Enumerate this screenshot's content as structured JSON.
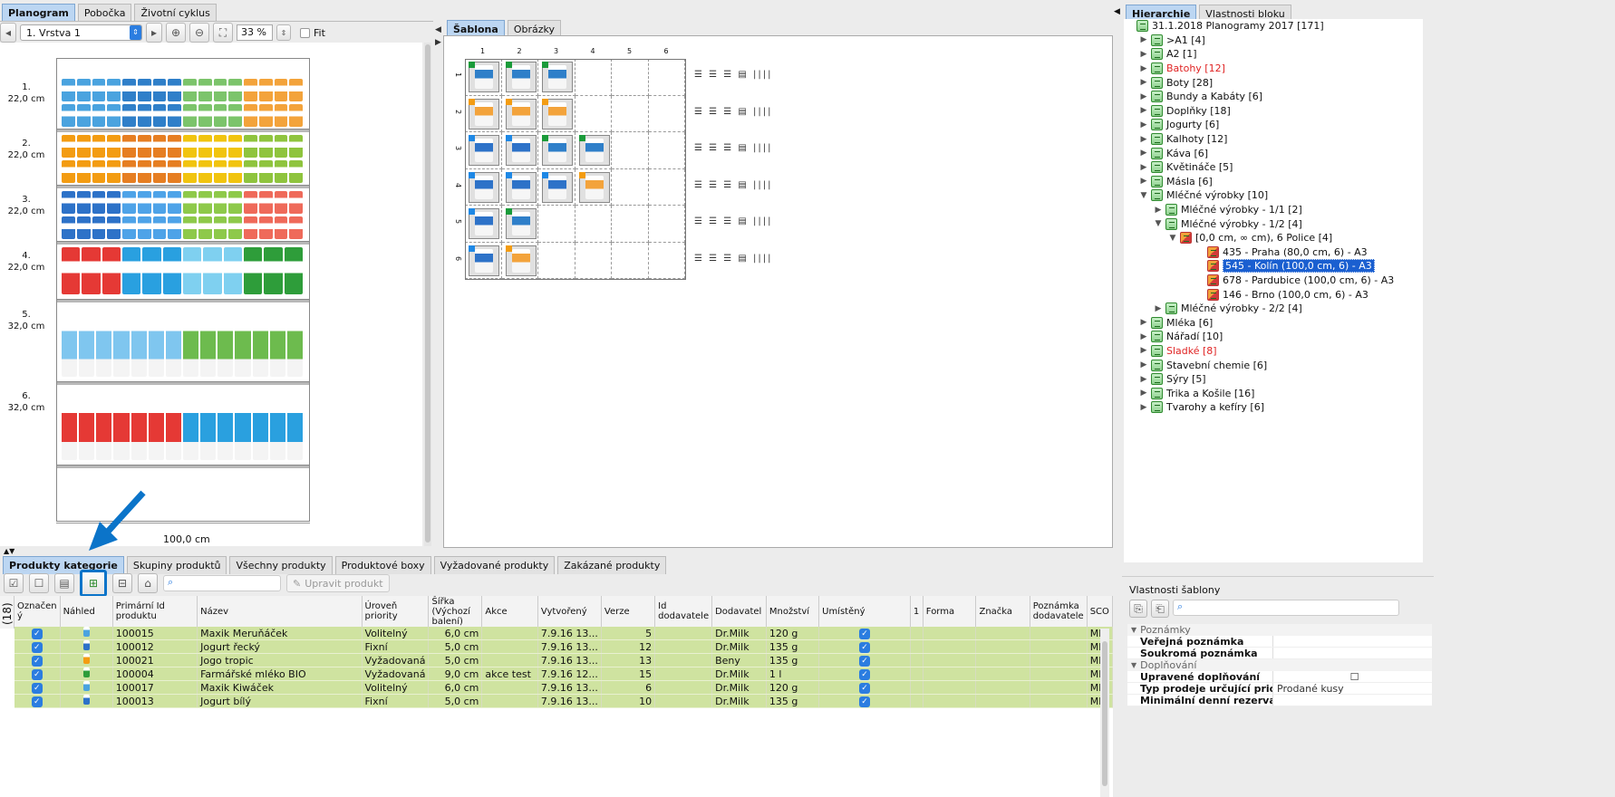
{
  "left_tabs": [
    {
      "label": "Planogram",
      "active": true
    },
    {
      "label": "Pobočka",
      "active": false
    },
    {
      "label": "Životní cyklus",
      "active": false
    }
  ],
  "toolbar": {
    "layer": "1. Vrstva 1",
    "zoom": "33 %",
    "fit": "Fit"
  },
  "shelves": [
    {
      "num": "1.",
      "h": "22,0 cm"
    },
    {
      "num": "2.",
      "h": "22,0 cm"
    },
    {
      "num": "3.",
      "h": "22,0 cm"
    },
    {
      "num": "4.",
      "h": "22,0 cm"
    },
    {
      "num": "5.",
      "h": "32,0 cm"
    },
    {
      "num": "6.",
      "h": "32,0 cm"
    }
  ],
  "width_label": "100,0 cm",
  "center_tabs": [
    {
      "label": "Šablona",
      "active": true
    },
    {
      "label": "Obrázky",
      "active": false
    }
  ],
  "template": {
    "cols": [
      "1",
      "2",
      "3",
      "4",
      "5",
      "6"
    ],
    "rows": [
      "1",
      "2",
      "3",
      "4",
      "5",
      "6"
    ],
    "cells": [
      [
        "g",
        "g",
        "g"
      ],
      [
        "o",
        "o",
        "o"
      ],
      [
        "b",
        "b",
        "g",
        "g"
      ],
      [
        "b",
        "b",
        "b",
        "o"
      ],
      [
        "b",
        "g"
      ],
      [
        "b",
        "o"
      ]
    ]
  },
  "right_tabs": [
    {
      "label": "Hierarchie",
      "active": true
    },
    {
      "label": "Vlastnosti bloku",
      "active": false
    }
  ],
  "tree": [
    {
      "t": "31.1.2018 Planogramy 2017 [171]",
      "lvl": 0,
      "tw": "",
      "icon": "doc",
      "red": false
    },
    {
      "t": ">A1 [4]",
      "lvl": 1,
      "tw": "▶",
      "icon": "list",
      "red": false
    },
    {
      "t": "A2 [1]",
      "lvl": 1,
      "tw": "▶",
      "icon": "list",
      "red": false
    },
    {
      "t": "Batohy [12]",
      "lvl": 1,
      "tw": "▶",
      "icon": "list",
      "red": true
    },
    {
      "t": "Boty [28]",
      "lvl": 1,
      "tw": "▶",
      "icon": "list",
      "red": false
    },
    {
      "t": "Bundy a Kabáty [6]",
      "lvl": 1,
      "tw": "▶",
      "icon": "list",
      "red": false
    },
    {
      "t": "Doplňky [18]",
      "lvl": 1,
      "tw": "▶",
      "icon": "list",
      "red": false
    },
    {
      "t": "Jogurty [6]",
      "lvl": 1,
      "tw": "▶",
      "icon": "list",
      "red": false
    },
    {
      "t": "Kalhoty [12]",
      "lvl": 1,
      "tw": "▶",
      "icon": "list",
      "red": false
    },
    {
      "t": "Káva [6]",
      "lvl": 1,
      "tw": "▶",
      "icon": "list",
      "red": false
    },
    {
      "t": "Květináče [5]",
      "lvl": 1,
      "tw": "▶",
      "icon": "list",
      "red": false
    },
    {
      "t": "Másla [6]",
      "lvl": 1,
      "tw": "▶",
      "icon": "list",
      "red": false
    },
    {
      "t": "Mléčné výrobky [10]",
      "lvl": 1,
      "tw": "▼",
      "icon": "list",
      "red": false
    },
    {
      "t": "Mléčné výrobky - 1/1 [2]",
      "lvl": 2,
      "tw": "▶",
      "icon": "list",
      "red": false
    },
    {
      "t": "Mléčné výrobky - 1/2 [4]",
      "lvl": 2,
      "tw": "▼",
      "icon": "list",
      "red": false
    },
    {
      "t": "[0,0 cm, ∞ cm), 6 Police [4]",
      "lvl": 3,
      "tw": "▼",
      "icon": "store",
      "red": false
    },
    {
      "t": "435 - Praha  (80,0 cm, 6) - A3",
      "lvl": 4,
      "tw": "",
      "icon": "store",
      "red": false
    },
    {
      "t": "545 - Kolín (100,0 cm, 6) - A3",
      "lvl": 4,
      "tw": "",
      "icon": "store",
      "red": false,
      "sel": true
    },
    {
      "t": "678 - Pardubice  (100,0 cm, 6) - A3",
      "lvl": 4,
      "tw": "",
      "icon": "store",
      "red": false
    },
    {
      "t": "146 - Brno (100,0 cm, 6) - A3",
      "lvl": 4,
      "tw": "",
      "icon": "store",
      "red": false
    },
    {
      "t": "Mléčné výrobky - 2/2 [4]",
      "lvl": 2,
      "tw": "▶",
      "icon": "list",
      "red": false
    },
    {
      "t": "Mléka [6]",
      "lvl": 1,
      "tw": "▶",
      "icon": "list",
      "red": false
    },
    {
      "t": "Nářadí [10]",
      "lvl": 1,
      "tw": "▶",
      "icon": "list",
      "red": false
    },
    {
      "t": "Sladké [8]",
      "lvl": 1,
      "tw": "▶",
      "icon": "list",
      "red": true
    },
    {
      "t": "Stavební chemie [6]",
      "lvl": 1,
      "tw": "▶",
      "icon": "list",
      "red": false
    },
    {
      "t": "Sýry [5]",
      "lvl": 1,
      "tw": "▶",
      "icon": "list",
      "red": false
    },
    {
      "t": "Trika a Košile [16]",
      "lvl": 1,
      "tw": "▶",
      "icon": "list",
      "red": false
    },
    {
      "t": "Tvarohy a kefíry [6]",
      "lvl": 1,
      "tw": "▶",
      "icon": "list",
      "red": false
    }
  ],
  "bottom_tabs": [
    "Produkty kategorie",
    "Skupiny produktů",
    "Všechny produkty",
    "Produktové boxy",
    "Vyžadované produkty",
    "Zakázané produkty"
  ],
  "edit_product": "Upravit produkt",
  "row_count": "(18)",
  "columns": [
    "Označen ý",
    "Náhled",
    "Primární Id produktu",
    "Název",
    "Úroveň priority",
    "Šířka (Výchozí balení)",
    "Akce",
    "Vytvořený",
    "Verze",
    "Id dodavatele",
    "Dodavatel",
    "Množství",
    "Umístěný",
    "1",
    "Forma",
    "Značka",
    "Poznámka dodavatele",
    "SCO"
  ],
  "rows": [
    {
      "id": "100015",
      "name": "Maxik Meruňáček",
      "prio": "Volitelný",
      "w": "6,0 cm",
      "akce": "",
      "created": "7.9.16 13...",
      "ver": "5",
      "sup": "Dr.Milk",
      "qty": "120 g",
      "sco": "Mlé"
    },
    {
      "id": "100012",
      "name": "Jogurt řecký",
      "prio": "Fixní",
      "w": "5,0 cm",
      "akce": "",
      "created": "7.9.16 13...",
      "ver": "12",
      "sup": "Dr.Milk",
      "qty": "135 g",
      "sco": "Mlé"
    },
    {
      "id": "100021",
      "name": "Jogo tropic",
      "prio": "Vyžadovaná",
      "w": "5,0 cm",
      "akce": "",
      "created": "7.9.16 13...",
      "ver": "13",
      "sup": "Beny",
      "qty": "135 g",
      "sco": "Mlé"
    },
    {
      "id": "100004",
      "name": "Farmářské mléko BIO",
      "prio": "Vyžadovaná",
      "w": "9,0 cm",
      "akce": "akce test",
      "created": "7.9.16 12...",
      "ver": "15",
      "sup": "Dr.Milk",
      "qty": "1 l",
      "sco": "Mlé"
    },
    {
      "id": "100017",
      "name": "Maxik Kiwáček",
      "prio": "Volitelný",
      "w": "6,0 cm",
      "akce": "",
      "created": "7.9.16 13...",
      "ver": "6",
      "sup": "Dr.Milk",
      "qty": "120 g",
      "sco": "Mlé"
    },
    {
      "id": "100013",
      "name": "Jogurt bílý",
      "prio": "Fixní",
      "w": "5,0 cm",
      "akce": "",
      "created": "7.9.16 13...",
      "ver": "10",
      "sup": "Dr.Milk",
      "qty": "135 g",
      "sco": "Mlé"
    }
  ],
  "props": {
    "title": "Vlastnosti šablony",
    "sections": [
      {
        "h": "Poznámky",
        "items": [
          {
            "k": "Veřejná poznámka",
            "v": ""
          },
          {
            "k": "Soukromá poznámka",
            "v": ""
          }
        ]
      },
      {
        "h": "Doplňování",
        "items": [
          {
            "k": "Upravené doplňování",
            "v": "☐"
          },
          {
            "k": "Typ prodeje určující prioritu ...",
            "v": "Prodané kusy"
          },
          {
            "k": "Minimální denní rezerva",
            "v": ""
          }
        ]
      }
    ]
  },
  "colors": {
    "accent": "#0b74c9",
    "selection": "#1a5fd0",
    "row": "#cfe3a0"
  }
}
